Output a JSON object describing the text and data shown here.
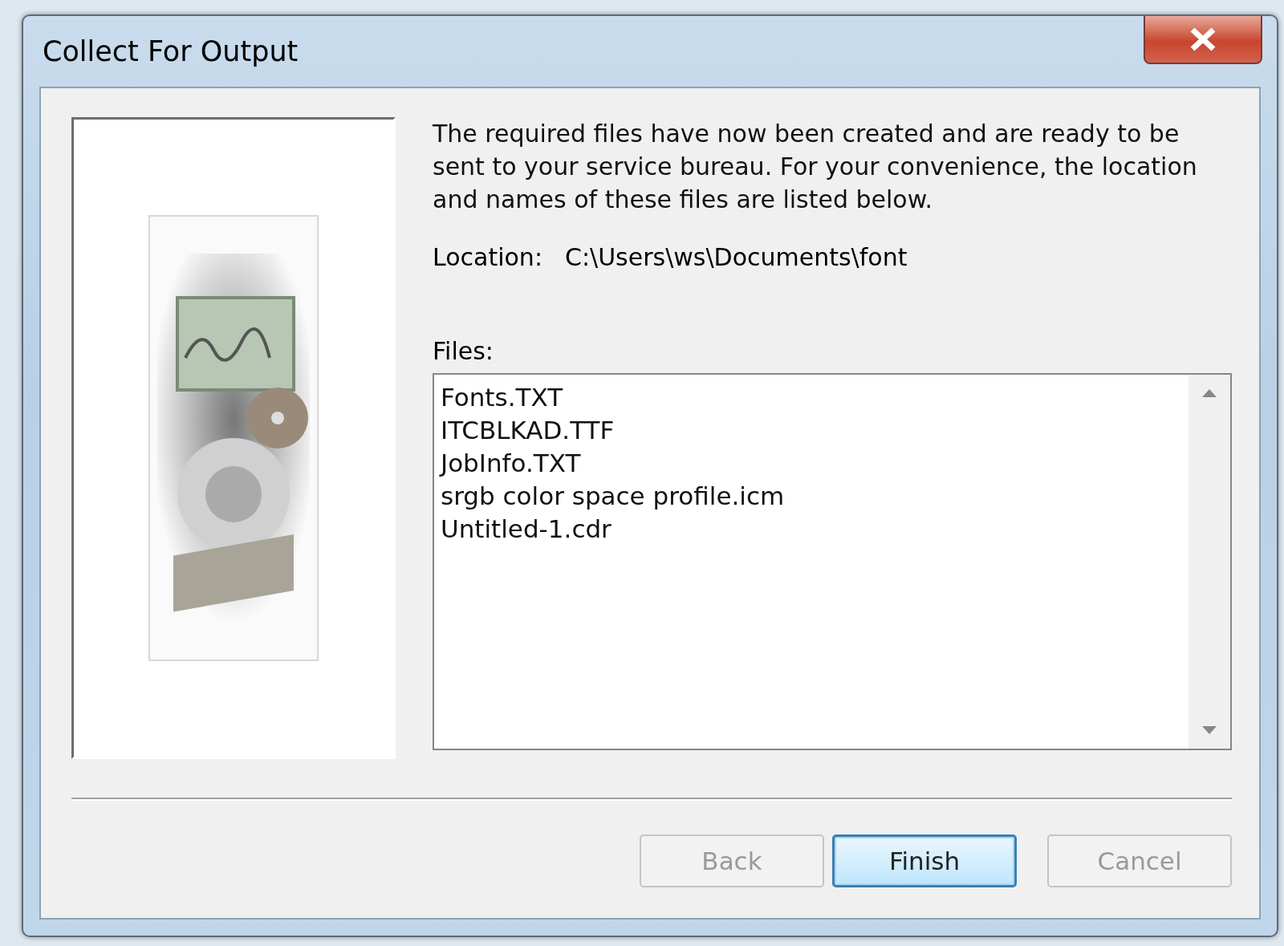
{
  "window": {
    "title": "Collect For Output"
  },
  "message": "The required files have now been created and are ready to be sent to your service bureau. For your convenience, the location and names of these files are listed below.",
  "location": {
    "label": "Location:",
    "value": "C:\\Users\\ws\\Documents\\font"
  },
  "files": {
    "label": "Files:",
    "items": [
      "Fonts.TXT",
      "ITCBLKAD.TTF",
      "JobInfo.TXT",
      "srgb color space profile.icm",
      "Untitled-1.cdr"
    ]
  },
  "buttons": [
    {
      "label": "Back",
      "disabled": true,
      "default": false
    },
    {
      "label": "Finish",
      "disabled": false,
      "default": true
    },
    {
      "label": "Cancel",
      "disabled": true,
      "default": false
    }
  ]
}
